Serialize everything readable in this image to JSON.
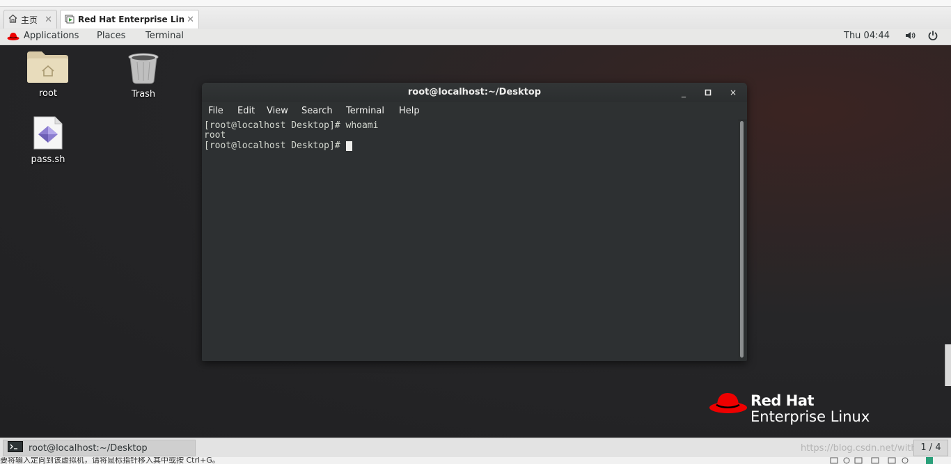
{
  "host": {
    "tabs": [
      {
        "label": "主页"
      },
      {
        "label": "Red Hat Enterprise Linux ..."
      }
    ],
    "close_glyph": "✕",
    "status_text": "要将输入定向到该虚拟机，请将鼠标指针移入其中或按 Ctrl+G。"
  },
  "guest": {
    "topbar": {
      "applications": "Applications",
      "places": "Places",
      "terminal": "Terminal",
      "clock": "Thu 04:44"
    },
    "desktop_icons": [
      {
        "label": "root",
        "icon": "home-folder-icon"
      },
      {
        "label": "Trash",
        "icon": "trash-icon"
      },
      {
        "label": "pass.sh",
        "icon": "script-file-icon"
      }
    ],
    "terminal_window": {
      "title": "root@localhost:~/Desktop",
      "minimize": "_",
      "maximize": "□",
      "close": "×",
      "menu": [
        "File",
        "Edit",
        "View",
        "Search",
        "Terminal",
        "Help"
      ],
      "lines": [
        "[root@localhost Desktop]# whoami",
        "root",
        "[root@localhost Desktop]# "
      ]
    },
    "logo": {
      "line1": "Red Hat",
      "line2": "Enterprise Linux"
    },
    "taskbar": {
      "task_label": "root@localhost:~/Desktop",
      "workspace": "1 / 4",
      "watermark": "https://blog.csdn.net/with_cat"
    }
  },
  "colors": {
    "redhat_red": "#ee0000",
    "terminal_bg": "#2d3032",
    "panel_bg": "#e8e8e7"
  }
}
